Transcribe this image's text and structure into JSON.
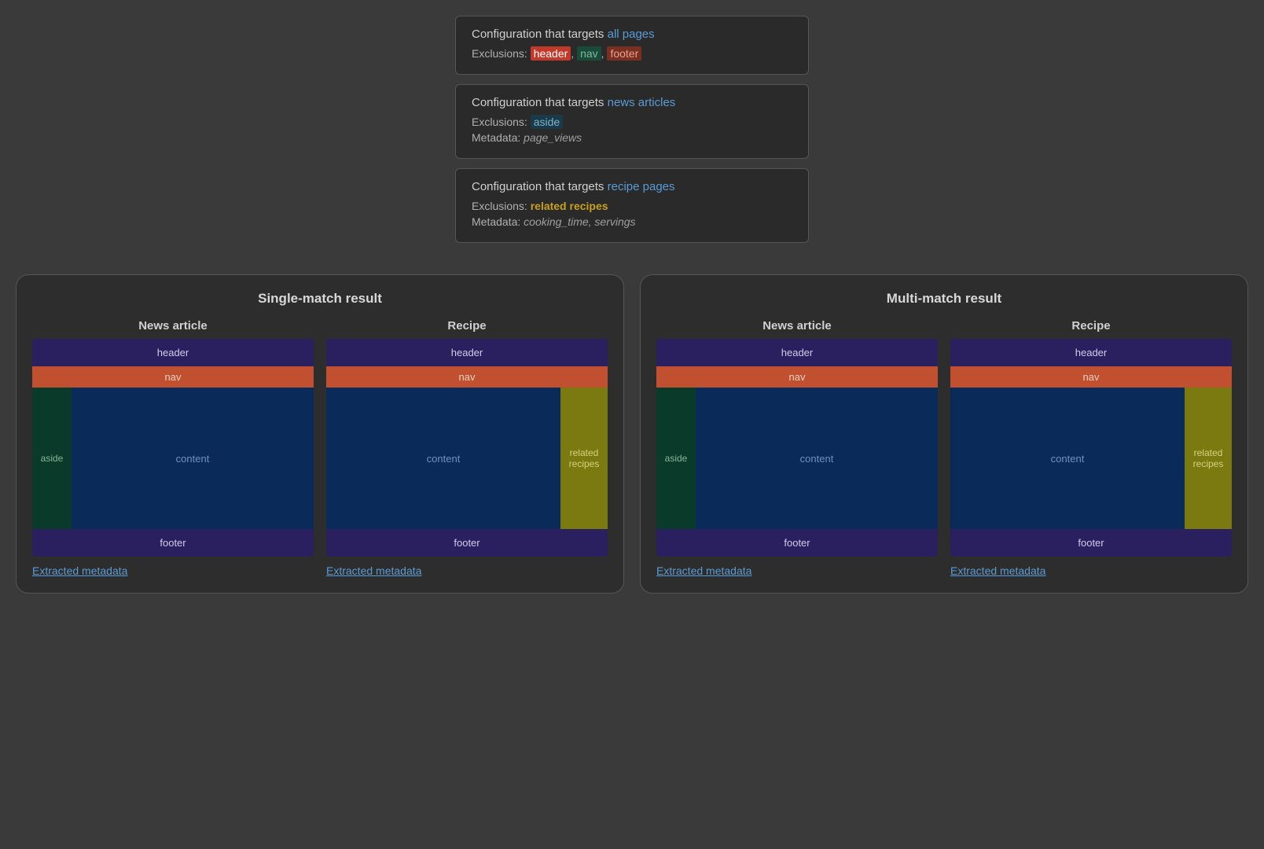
{
  "configs": [
    {
      "id": "config1",
      "title_prefix": "Configuration that targets ",
      "title_target": "all pages",
      "exclusions_label": "Exclusions: ",
      "exclusions_tags": [
        "header",
        "nav",
        "footer"
      ],
      "metadata": null
    },
    {
      "id": "config2",
      "title_prefix": "Configuration that targets ",
      "title_target": "news articles",
      "exclusions_label": "Exclusions: ",
      "exclusions_tags": [
        "aside"
      ],
      "metadata_label": "Metadata: ",
      "metadata_value": "page_views"
    },
    {
      "id": "config3",
      "title_prefix": "Configuration that targets ",
      "title_target": "recipe pages",
      "exclusions_label": "Exclusions: ",
      "exclusions_tags": [
        "related recipes"
      ],
      "metadata_label": "Metadata: ",
      "metadata_value": "cooking_time, servings"
    }
  ],
  "panels": [
    {
      "id": "single-match",
      "title": "Single-match result",
      "articles": [
        {
          "label": "News article",
          "has_aside": true,
          "has_related": false,
          "sections": {
            "header": "header",
            "nav": "nav",
            "aside": "aside",
            "content": "content",
            "footer": "footer"
          }
        },
        {
          "label": "Recipe",
          "has_aside": false,
          "has_related": true,
          "sections": {
            "header": "header",
            "nav": "nav",
            "content": "content",
            "related": "related\nrecipes",
            "footer": "footer"
          }
        }
      ],
      "extracted_label": "Extracted metadata"
    },
    {
      "id": "multi-match",
      "title": "Multi-match result",
      "articles": [
        {
          "label": "News article",
          "has_aside": true,
          "has_related": false,
          "sections": {
            "header": "header",
            "nav": "nav",
            "aside": "aside",
            "content": "content",
            "footer": "footer"
          }
        },
        {
          "label": "Recipe",
          "has_aside": false,
          "has_related": true,
          "sections": {
            "header": "header",
            "nav": "nav",
            "content": "content",
            "related": "related\nrecipes",
            "footer": "footer"
          }
        }
      ],
      "extracted_label": "Extracted metadata"
    }
  ]
}
